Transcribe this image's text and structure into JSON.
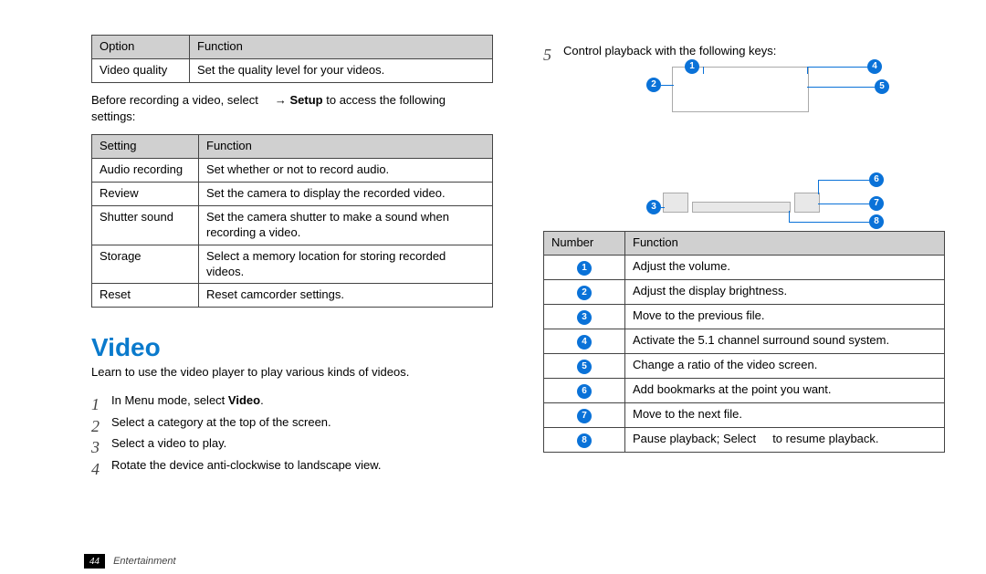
{
  "left": {
    "table1": {
      "h1": "Option",
      "h2": "Function",
      "r1c1": "Video quality",
      "r1c2": "Set the quality level for your videos."
    },
    "preSettings_a": "Before recording a video, select",
    "preSettings_setup": "Setup",
    "preSettings_b": " to access the following settings:",
    "table2": {
      "h1": "Setting",
      "h2": "Function",
      "rows": [
        {
          "c1": "Audio recording",
          "c2": "Set whether or not to record audio."
        },
        {
          "c1": "Review",
          "c2": "Set the camera to display the recorded video."
        },
        {
          "c1": "Shutter sound",
          "c2": "Set the camera shutter to make a sound when recording a video."
        },
        {
          "c1": "Storage",
          "c2": "Select a memory location for storing recorded videos."
        },
        {
          "c1": "Reset",
          "c2": "Reset camcorder settings."
        }
      ]
    },
    "section_title": "Video",
    "section_intro": "Learn to use the video player to play various kinds of videos.",
    "steps": [
      {
        "n": "1",
        "t_a": "In Menu mode, select ",
        "bold": "Video",
        "t_b": "."
      },
      {
        "n": "2",
        "t_a": "Select a category at the top of the screen.",
        "bold": "",
        "t_b": ""
      },
      {
        "n": "3",
        "t_a": "Select a video to play.",
        "bold": "",
        "t_b": ""
      },
      {
        "n": "4",
        "t_a": "Rotate the device anti-clockwise to landscape view.",
        "bold": "",
        "t_b": ""
      }
    ]
  },
  "right": {
    "step5_n": "5",
    "step5_t": "Control playback with the following keys:",
    "labels": {
      "l1": "1",
      "l2": "2",
      "l3": "3",
      "l4": "4",
      "l5": "5",
      "l6": "6",
      "l7": "7",
      "l8": "8"
    },
    "table3": {
      "h1": "Number",
      "h2": "Function",
      "rows": [
        {
          "n": "1",
          "f": "Adjust the volume."
        },
        {
          "n": "2",
          "f": "Adjust the display brightness."
        },
        {
          "n": "3",
          "f": "Move to the previous file."
        },
        {
          "n": "4",
          "f": "Activate the 5.1 channel surround sound system."
        },
        {
          "n": "5",
          "f": "Change a ratio of the video screen."
        },
        {
          "n": "6",
          "f": "Add bookmarks at the point you want."
        },
        {
          "n": "7",
          "f": "Move to the next file."
        },
        {
          "n": "8",
          "f_a": "Pause playback; Select ",
          "f_b": " to resume playback."
        }
      ]
    }
  },
  "footer": {
    "page": "44",
    "chapter": "Entertainment"
  }
}
